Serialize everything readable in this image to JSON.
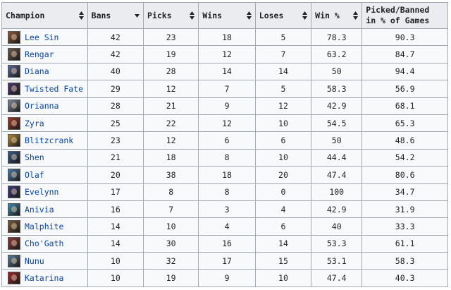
{
  "columns": [
    {
      "label": "Champion",
      "sort": "both"
    },
    {
      "label": "Bans",
      "sort": "desc"
    },
    {
      "label": "Picks",
      "sort": "both"
    },
    {
      "label": "Wins",
      "sort": "both"
    },
    {
      "label": "Loses",
      "sort": "both"
    },
    {
      "label": "Win %",
      "sort": "both"
    },
    {
      "label": "Picked/Banned in % of Games",
      "sort": "none"
    }
  ],
  "rows": [
    {
      "champion": "Lee Sin",
      "bans": "42",
      "picks": "23",
      "wins": "18",
      "loses": "5",
      "win_pct": "78.3",
      "pb_pct": "90.3",
      "icon": "lee-sin-portrait-icon",
      "color": "#8a5a3a"
    },
    {
      "champion": "Rengar",
      "bans": "42",
      "picks": "19",
      "wins": "12",
      "loses": "7",
      "win_pct": "63.2",
      "pb_pct": "84.7",
      "icon": "rengar-portrait-icon",
      "color": "#6b5a4a"
    },
    {
      "champion": "Diana",
      "bans": "40",
      "picks": "28",
      "wins": "14",
      "loses": "14",
      "win_pct": "50",
      "pb_pct": "94.4",
      "icon": "diana-portrait-icon",
      "color": "#5a6a9a"
    },
    {
      "champion": "Twisted Fate",
      "bans": "29",
      "picks": "12",
      "wins": "7",
      "loses": "5",
      "win_pct": "58.3",
      "pb_pct": "56.9",
      "icon": "twisted-fate-portrait-icon",
      "color": "#4a3a6a"
    },
    {
      "champion": "Orianna",
      "bans": "28",
      "picks": "21",
      "wins": "9",
      "loses": "12",
      "win_pct": "42.9",
      "pb_pct": "68.1",
      "icon": "orianna-portrait-icon",
      "color": "#7a8a9a"
    },
    {
      "champion": "Zyra",
      "bans": "25",
      "picks": "22",
      "wins": "12",
      "loses": "10",
      "win_pct": "54.5",
      "pb_pct": "65.3",
      "icon": "zyra-portrait-icon",
      "color": "#9a3a2a"
    },
    {
      "champion": "Blitzcrank",
      "bans": "23",
      "picks": "12",
      "wins": "6",
      "loses": "6",
      "win_pct": "50",
      "pb_pct": "48.6",
      "icon": "blitzcrank-portrait-icon",
      "color": "#b08a3a"
    },
    {
      "champion": "Shen",
      "bans": "21",
      "picks": "18",
      "wins": "8",
      "loses": "10",
      "win_pct": "44.4",
      "pb_pct": "54.2",
      "icon": "shen-portrait-icon",
      "color": "#3a5a8a"
    },
    {
      "champion": "Olaf",
      "bans": "20",
      "picks": "38",
      "wins": "18",
      "loses": "20",
      "win_pct": "47.4",
      "pb_pct": "80.6",
      "icon": "olaf-portrait-icon",
      "color": "#4a7aaa"
    },
    {
      "champion": "Evelynn",
      "bans": "17",
      "picks": "8",
      "wins": "8",
      "loses": "0",
      "win_pct": "100",
      "pb_pct": "34.7",
      "icon": "evelynn-portrait-icon",
      "color": "#3a3a7a"
    },
    {
      "champion": "Anivia",
      "bans": "16",
      "picks": "7",
      "wins": "3",
      "loses": "4",
      "win_pct": "42.9",
      "pb_pct": "31.9",
      "icon": "anivia-portrait-icon",
      "color": "#3a8ab0"
    },
    {
      "champion": "Malphite",
      "bans": "14",
      "picks": "10",
      "wins": "4",
      "loses": "6",
      "win_pct": "40",
      "pb_pct": "33.3",
      "icon": "malphite-portrait-icon",
      "color": "#7a5a3a"
    },
    {
      "champion": "Cho'Gath",
      "bans": "14",
      "picks": "30",
      "wins": "16",
      "loses": "14",
      "win_pct": "53.3",
      "pb_pct": "61.1",
      "icon": "chogath-portrait-icon",
      "color": "#8a3a3a"
    },
    {
      "champion": "Nunu",
      "bans": "10",
      "picks": "32",
      "wins": "17",
      "loses": "15",
      "win_pct": "53.1",
      "pb_pct": "58.3",
      "icon": "nunu-portrait-icon",
      "color": "#5a7a9a"
    },
    {
      "champion": "Katarina",
      "bans": "10",
      "picks": "19",
      "wins": "9",
      "loses": "10",
      "win_pct": "47.4",
      "pb_pct": "40.3",
      "icon": "katarina-portrait-icon",
      "color": "#9a2a2a"
    }
  ],
  "colors": {
    "header_bg": "#eaecf0",
    "cell_bg": "#f8f9fa",
    "border": "#a2a9b1",
    "link": "#0645ad"
  }
}
